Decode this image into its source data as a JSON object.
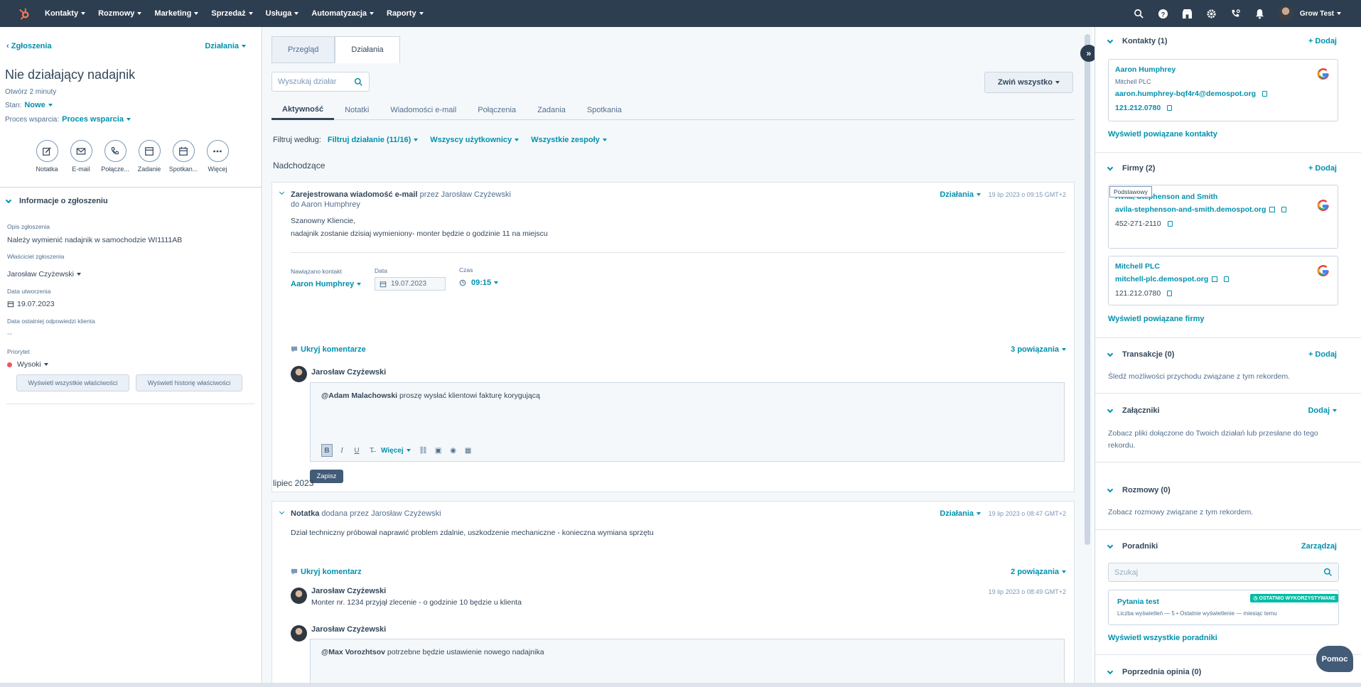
{
  "nav": {
    "items": [
      "Kontakty",
      "Rozmowy",
      "Marketing",
      "Sprzedaż",
      "Usługa",
      "Automatyzacja",
      "Raporty"
    ],
    "account": "Grow Test"
  },
  "left": {
    "back": "Zgłoszenia",
    "actions": "Działania",
    "title": "Nie działający nadajnik",
    "opened": "Otwórz 2 minuty",
    "status_label": "Stan:",
    "status_value": "Nowe",
    "pipeline_label": "Proces wsparcia:",
    "pipeline_value": "Proces wsparcia",
    "quick_actions": [
      "Notatka",
      "E-mail",
      "Połącze...",
      "Zadanie",
      "Spotkan...",
      "Więcej"
    ],
    "section_title": "Informacje o zgłoszeniu",
    "props": [
      {
        "label": "Opis zgłoszenia",
        "value": "Należy wymienić nadajnik w samochodzie WI1111AB"
      },
      {
        "label": "Właściciel zgłoszenia",
        "value": "Jarosław Czyżewski"
      },
      {
        "label": "Data utworzenia",
        "value": "19.07.2023"
      },
      {
        "label": "Data ostatniej odpowiedzi klienta",
        "value": "--"
      },
      {
        "label": "Priorytet",
        "value": "Wysoki"
      }
    ],
    "btn_all_props": "Wyświetl wszystkie właściwości",
    "btn_history": "Wyświetl historię właściwości"
  },
  "middle": {
    "tabs": [
      "Przegląd",
      "Działania"
    ],
    "search_placeholder": "Wyszukaj działar",
    "collapse": "Zwiń wszystko",
    "subtabs": [
      "Aktywność",
      "Notatki",
      "Wiadomości e-mail",
      "Połączenia",
      "Zadania",
      "Spotkania"
    ],
    "filter_label": "Filtruj według:",
    "filters": [
      "Filtruj działanie (11/16)",
      "Wszyscy użytkownicy",
      "Wszystkie zespoły"
    ],
    "upcoming": "Nadchodzące",
    "email_card": {
      "title_bold": "Zarejestrowana wiadomość e-mail",
      "title_rest": " przez Jarosław Czyżewski",
      "to": "do Aaron Humphrey",
      "actions": "Działania",
      "time": "19 lip 2023 o 09:15 GMT+2",
      "line1": "Szanowny Kliencie,",
      "line2": "nadajnik zostanie dzisiaj wymieniony- monter będzie o godzinie 11 na miejscu",
      "contacted_label": "Nawiązano kontakt",
      "contacted_value": "Aaron Humphrey",
      "date_label": "Data",
      "date_value": "19.07.2023",
      "time_label": "Czas",
      "time_value": "09:15",
      "hide_comments": "Ukryj komentarze",
      "assoc": "3 powiązania",
      "commenter": "Jarosław Czyżewski",
      "mention": "@Adam Malachowski",
      "comment": " proszę wysłać klientowi fakturę korygującą",
      "more": "Więcej",
      "save": "Zapisz"
    },
    "month": "lipiec 2023",
    "note_card": {
      "title_bold": "Notatka",
      "title_rest": " dodana przez Jarosław Czyżewski",
      "actions": "Działania",
      "time": "19 lip 2023 o 08:47 GMT+2",
      "body": "Dział techniczny próbował naprawić problem zdalnie, uszkodzenie mechaniczne - konieczna wymiana sprzętu",
      "hide_comments": "Ukryj komentarz",
      "assoc": "2 powiązania",
      "commenter1": "Jarosław Czyżewski",
      "comment1_time": "19 lip 2023 o 08:49 GMT+2",
      "comment1": "Monter nr. 1234 przyjął zlecenie - o godzinie 10 będzie u klienta",
      "commenter2": "Jarosław Czyżewski",
      "mention2": "@Max Vorozhtsov",
      "comment2": " potrzebne będzie ustawienie nowego nadajnika"
    }
  },
  "right": {
    "add": "+ Dodaj",
    "contacts_title": "Kontakty (1)",
    "contact": {
      "name": "Aaron Humphrey",
      "company": "Mitchell PLC",
      "email": "aaron.humphrey-bqf4r4@demospot.org",
      "phone": "121.212.0780"
    },
    "view_contacts": "Wyświetl powiązane kontakty",
    "companies_title": "Firmy (2)",
    "primary": "Podstawowy",
    "company1": {
      "name": "Avila, Stephenson and Smith",
      "domain": "avila-stephenson-and-smith.demospot.org",
      "phone": "452-271-2110"
    },
    "company2": {
      "name": "Mitchell PLC",
      "domain": "mitchell-plc.demospot.org",
      "phone": "121.212.0780"
    },
    "view_companies": "Wyświetl powiązane firmy",
    "deals_title": "Transakcje (0)",
    "deals_text": "Śledź możliwości przychodu związane z tym rekordem.",
    "attach_title": "Załączniki",
    "attach_add": "Dodaj",
    "attach_text": "Zobacz pliki dołączone do Twoich działań lub przesłane do tego rekordu.",
    "conv_title": "Rozmowy (0)",
    "conv_text": "Zobacz rozmowy związane z tym rekordem.",
    "guides_title": "Poradniki",
    "guides_manage": "Zarządzaj",
    "guides_search": "Szukaj",
    "guide_name": "Pytania test",
    "guide_badge": "OSTATNIO WYKORZYSTYWANE",
    "guide_meta": "Liczba wyświetleń — 5 • Ostatnie wyświetlenie — miesiąc temu",
    "view_guides": "Wyświetl wszystkie poradniki",
    "feedback_title": "Poprzednia opinia (0)"
  },
  "help": "Pomoc",
  "colors": {
    "nav_bg": "#2d3e50",
    "link": "#0091ae",
    "priority_high": "#f2545b",
    "recent_badge": "#00bda5"
  }
}
